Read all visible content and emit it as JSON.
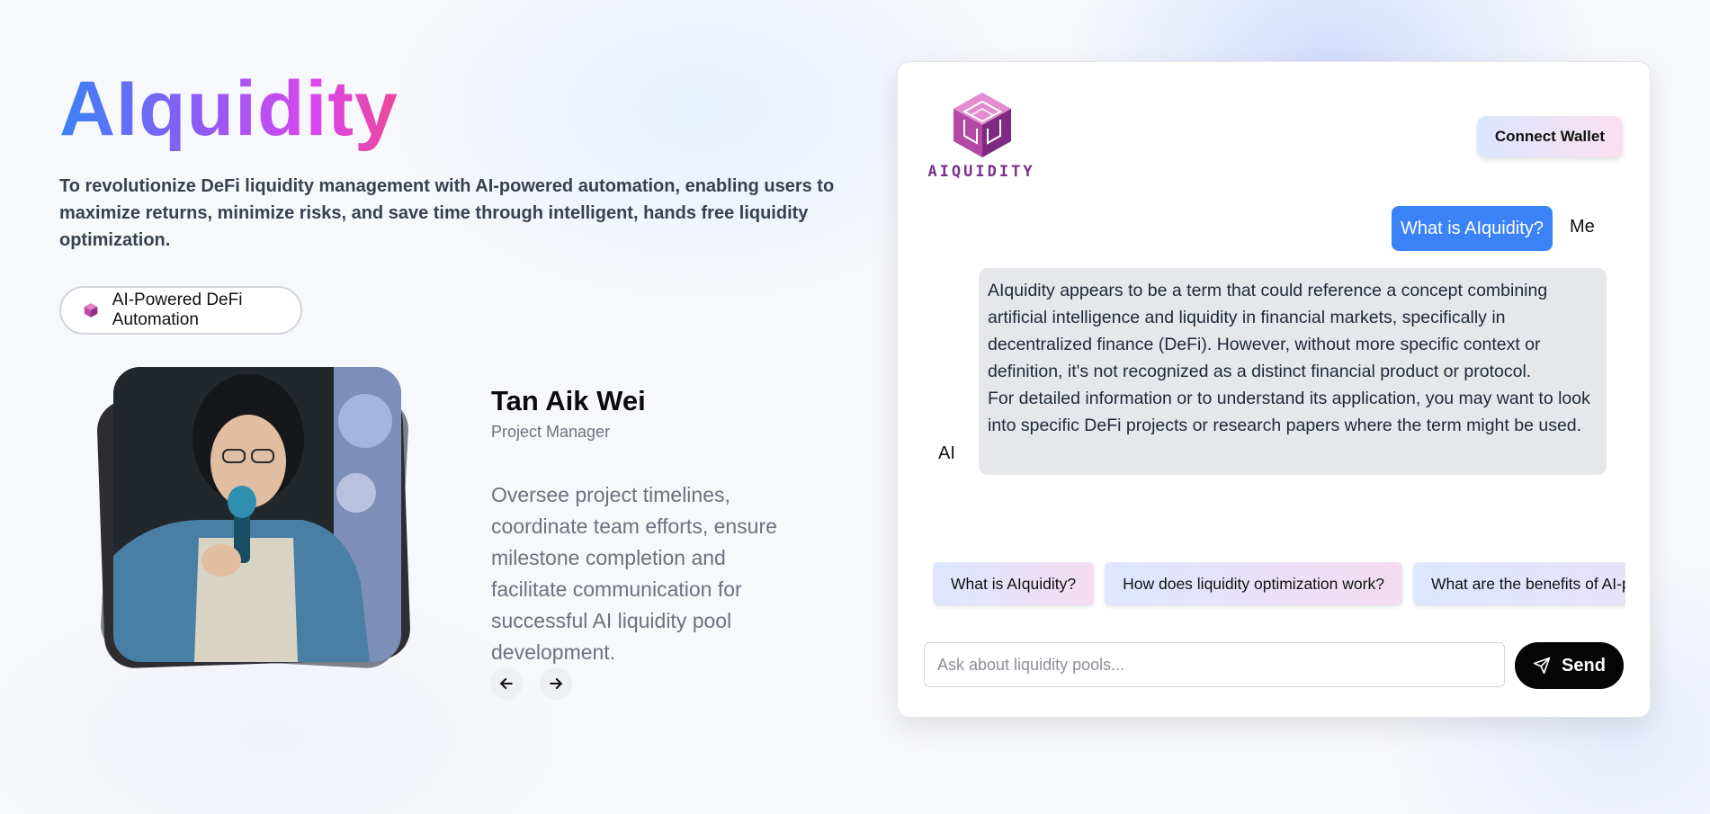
{
  "hero": {
    "title": "AIquidity",
    "mission": "To revolutionize DeFi liquidity management with AI-powered automation, enabling users to maximize returns, minimize risks, and save time through intelligent, hands free liquidity optimization.",
    "badge_label": "AI-Powered DeFi Automation"
  },
  "team": {
    "name": "Tan Aik Wei",
    "role": "Project Manager",
    "description": "Oversee project timelines, coordinate team efforts, ensure milestone completion and facilitate communication for successful AI liquidity pool development.",
    "prev_icon": "arrow-left-icon",
    "next_icon": "arrow-right-icon"
  },
  "chat": {
    "logo_text": "AIQUIDITY",
    "connect_label": "Connect Wallet",
    "user_message": "What is AIquidity?",
    "user_label": "Me",
    "ai_label": "AI",
    "ai_message_p1": "AIquidity appears to be a term that could reference a concept combining artificial intelligence and liquidity in financial markets, specifically in decentralized finance (DeFi). However, without more specific context or definition, it's not recognized as a distinct financial product or protocol.",
    "ai_message_p2": "For detailed information or to understand its application, you may want to look into specific DeFi projects or research papers where the term might be used.",
    "suggestions": [
      "What is AIquidity?",
      "How does liquidity optimization work?",
      "What are the benefits of AI-powered liquidity management?"
    ],
    "input_placeholder": "Ask about liquidity pools...",
    "input_value": "",
    "send_label": "Send",
    "send_icon": "paper-plane-icon"
  },
  "colors": {
    "title_gradient": [
      "#3b82f6",
      "#8b5cf6",
      "#d946ef",
      "#ec4899"
    ],
    "user_bubble": "#3b82f6",
    "ai_bubble": "#e5e7eb",
    "send_button": "#050505",
    "logo_purple": "#7a2f8c"
  }
}
